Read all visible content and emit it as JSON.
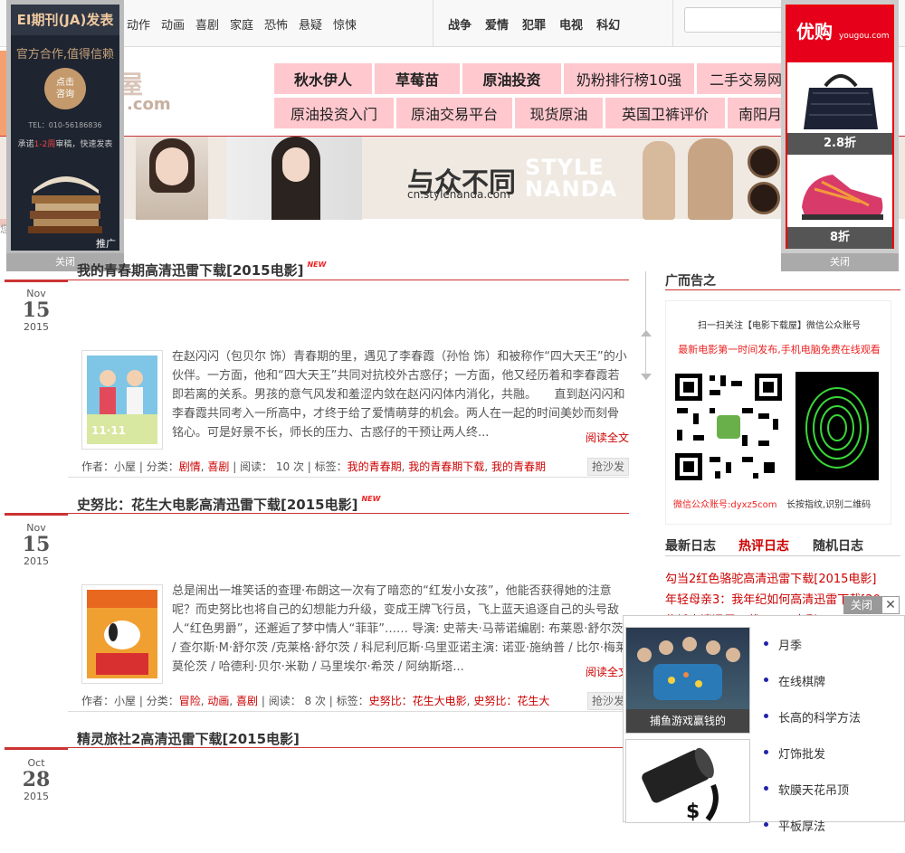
{
  "topnav": {
    "group1": [
      "动作",
      "动画",
      "喜剧",
      "家庭",
      "恐怖",
      "悬疑",
      "惊悚"
    ],
    "group2": [
      "战争",
      "爱情",
      "犯罪",
      "电视",
      "科幻"
    ]
  },
  "logo": {
    "text1": "屋",
    "text2": ".com"
  },
  "pinkmenu": {
    "row1": [
      "秋水伊人",
      "草莓苗",
      "原油投资",
      "奶粉排行榜10强",
      "二手交易网"
    ],
    "row2": [
      "原油投资入门",
      "原油交易平台",
      "现货原油",
      "英国卫裤评价",
      "南阳月"
    ]
  },
  "banner": {
    "slogan": "与众不同",
    "url": "cn.stylenanda.com",
    "brand1": "STYLE",
    "brand2": "NANDA"
  },
  "left_ad": {
    "title": "EI期刊(JA)发表",
    "line1": "官方合作,值得信赖",
    "circle1": "点击",
    "circle2": "咨询",
    "tel": "TEL：010-56186836",
    "promise_a": "承诺",
    "promise_b": "1-2周",
    "promise_c": "审稿，快速发表",
    "tui": "推广",
    "close": "关闭"
  },
  "right_ad": {
    "logo": "优购",
    "logo_small": "yougou.com",
    "label1": "2.8折",
    "label2": "8折",
    "close": "关闭"
  },
  "edge_text": "您",
  "posts": [
    {
      "title": "我的青春期高清迅雷下载[2015电影]",
      "new": "NEW",
      "month": "Nov",
      "day": "15",
      "year": "2015",
      "excerpt": "在赵闪闪（包贝尔 饰）青春期的里，遇见了李春霞（孙怡 饰）和被称作“四大天王”的小伙伴。一方面，他和“四大天王”共同对抗校外古惑仔；一方面，他又经历着和李春霞若即若离的关系。男孩的意气风发和羞涩内敛在赵闪闪体内消化，共融。　　直到赵闪闪和李春霞共同考入一所高中，才终于给了爱情萌芽的机会。两人在一起的时间美妙而刻骨铭心。可是好景不长，师长的压力、古惑仔的干预让两人终...",
      "readall": "阅读全文",
      "meta_author": "作者：小屋",
      "meta_cat_label": "分类：",
      "cats": [
        "剧情",
        "喜剧"
      ],
      "meta_reads": "阅读： 10 次",
      "meta_tag_label": "标签：",
      "tags": [
        "我的青春期",
        "我的青春期下载",
        "我的青春期"
      ],
      "sofa": "抢沙发"
    },
    {
      "title": "史努比：花生大电影高清迅雷下载[2015电影]",
      "new": "NEW",
      "month": "Nov",
      "day": "15",
      "year": "2015",
      "excerpt": "总是闹出一堆笑话的查理·布朗这一次有了暗恋的“红发小女孩”，他能否获得她的注意呢？而史努比也将自己的幻想能力升级，变成王牌飞行员，飞上蓝天追逐自己的头号敌人“红色男爵”，还邂逅了梦中情人“菲菲”…… 导演: 史蒂夫·马蒂诺编剧: 布莱恩·舒尔茨 / 查尔斯·M·舒尔茨 /克莱格·舒尔茨 / 科尼利厄斯·乌里亚诺主演: 诺亚·施纳普 / 比尔·梅莱莫伦茨 / 哈德利·贝尔·米勒 / 马里埃尔·希茨 / 阿纳斯塔...",
      "readall": "阅读全文",
      "meta_author": "作者：小屋",
      "meta_cat_label": "分类：",
      "cats": [
        "冒险",
        "动画",
        "喜剧"
      ],
      "meta_reads": "阅读： 8 次",
      "meta_tag_label": "标签：",
      "tags": [
        "史努比：花生大电影",
        "史努比：花生大"
      ],
      "sofa": "抢沙发"
    },
    {
      "title": "精灵旅社2高清迅雷下载[2015电影]",
      "month": "Oct",
      "day": "28",
      "year": "2015"
    }
  ],
  "sidebar": {
    "ad_title": "广而告之",
    "qr_line1": "扫一扫关注【电影下载屋】微信公众账号",
    "qr_line2": "最新电影第一时间发布,手机电脑免费在线观看",
    "qr_account": "微信公众账号:dyxz5com",
    "qr_hint": "长按指纹,识别二维码",
    "tabs": [
      "最新日志",
      "热评日志",
      "随机日志"
    ],
    "list": [
      "勾当2红色骆驼高清迅雷下载[2015电影]",
      "年轻母亲3：我年纪如何高清迅雷下载[20",
      "伪城高清迅雷下载[2006电影]"
    ]
  },
  "popup": {
    "close": "关闭",
    "x": "✕",
    "cap1": "捕鱼游戏赢钱的",
    "links": [
      "月季",
      "在线棋牌",
      "长高的科学方法",
      "灯饰批发",
      "软膜天花吊顶",
      "平板厚法"
    ]
  },
  "colors": {
    "accent": "#cc3333",
    "pink": "#ffc8ce",
    "link": "#cc0000"
  }
}
